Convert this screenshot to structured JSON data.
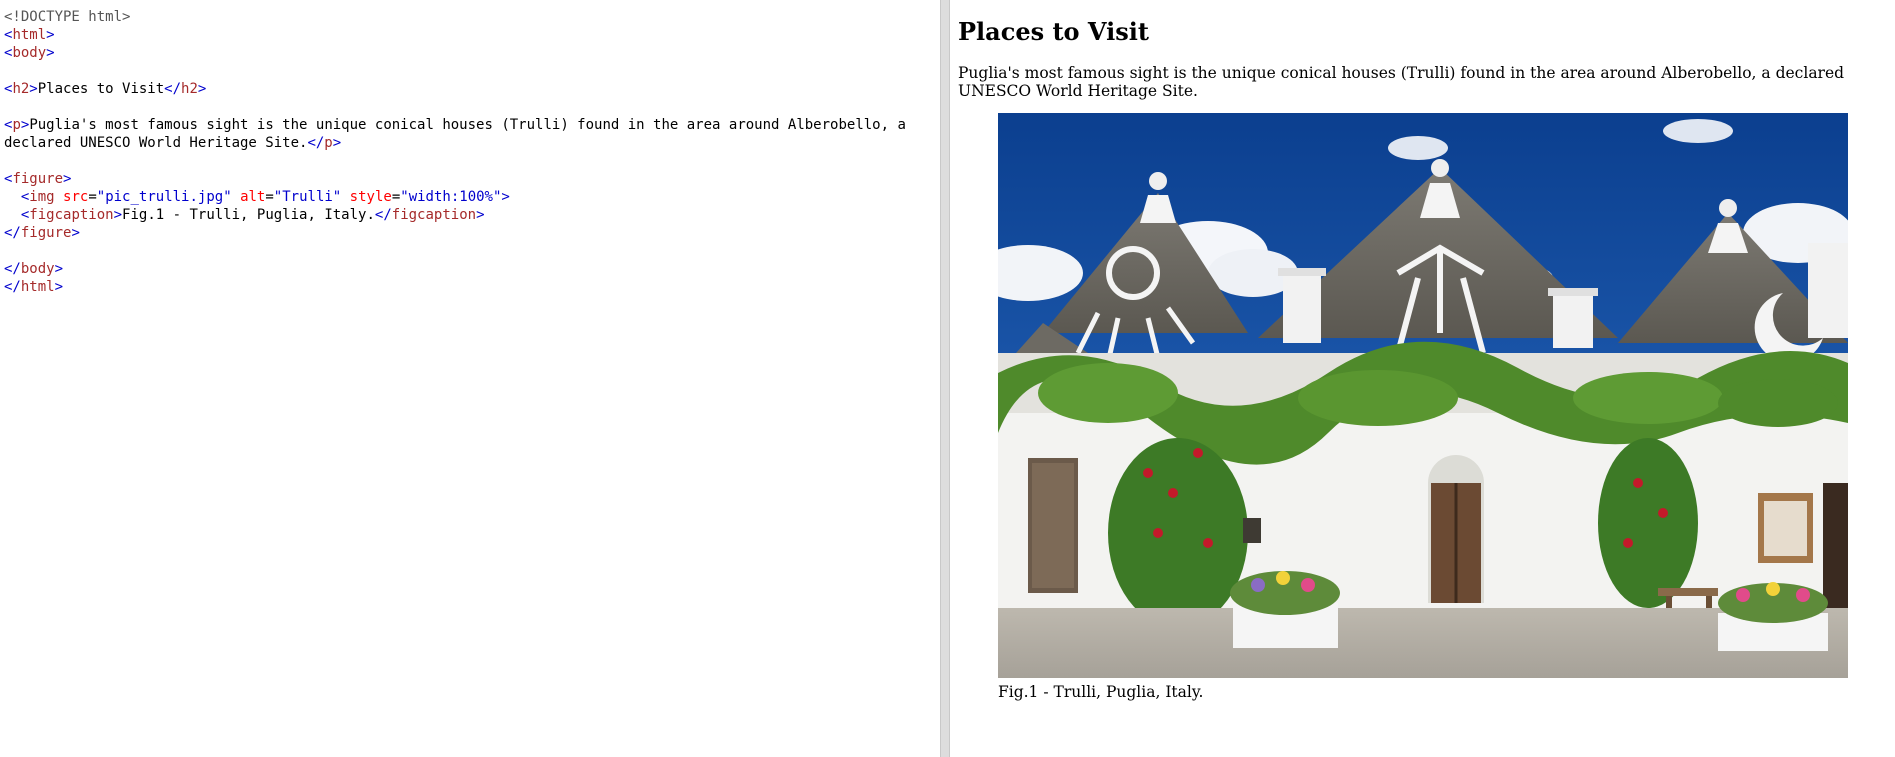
{
  "editor": {
    "lines": [
      [
        {
          "t": "doctype",
          "v": "<!DOCTYPE html>"
        }
      ],
      [
        {
          "t": "bracket",
          "v": "<"
        },
        {
          "t": "tag",
          "v": "html"
        },
        {
          "t": "bracket",
          "v": ">"
        }
      ],
      [
        {
          "t": "bracket",
          "v": "<"
        },
        {
          "t": "tag",
          "v": "body"
        },
        {
          "t": "bracket",
          "v": ">"
        }
      ],
      [],
      [
        {
          "t": "bracket",
          "v": "<"
        },
        {
          "t": "tag",
          "v": "h2"
        },
        {
          "t": "bracket",
          "v": ">"
        },
        {
          "t": "text",
          "v": "Places to Visit"
        },
        {
          "t": "bracket",
          "v": "</"
        },
        {
          "t": "tag",
          "v": "h2"
        },
        {
          "t": "bracket",
          "v": ">"
        }
      ],
      [],
      [
        {
          "t": "bracket",
          "v": "<"
        },
        {
          "t": "tag",
          "v": "p"
        },
        {
          "t": "bracket",
          "v": ">"
        },
        {
          "t": "text",
          "v": "Puglia's most famous sight is the unique conical houses (Trulli) found in the area around Alberobello, a declared UNESCO World Heritage Site."
        },
        {
          "t": "bracket",
          "v": "</"
        },
        {
          "t": "tag",
          "v": "p"
        },
        {
          "t": "bracket",
          "v": ">"
        }
      ],
      [],
      [
        {
          "t": "bracket",
          "v": "<"
        },
        {
          "t": "tag",
          "v": "figure"
        },
        {
          "t": "bracket",
          "v": ">"
        }
      ],
      [
        {
          "t": "text",
          "v": "  "
        },
        {
          "t": "bracket",
          "v": "<"
        },
        {
          "t": "tag",
          "v": "img"
        },
        {
          "t": "text",
          "v": " "
        },
        {
          "t": "attr",
          "v": "src"
        },
        {
          "t": "eq",
          "v": "="
        },
        {
          "t": "val",
          "v": "\"pic_trulli.jpg\""
        },
        {
          "t": "text",
          "v": " "
        },
        {
          "t": "attr",
          "v": "alt"
        },
        {
          "t": "eq",
          "v": "="
        },
        {
          "t": "val",
          "v": "\"Trulli\""
        },
        {
          "t": "text",
          "v": " "
        },
        {
          "t": "attr",
          "v": "style"
        },
        {
          "t": "eq",
          "v": "="
        },
        {
          "t": "val",
          "v": "\"width:100%\""
        },
        {
          "t": "bracket",
          "v": ">"
        }
      ],
      [
        {
          "t": "text",
          "v": "  "
        },
        {
          "t": "bracket",
          "v": "<"
        },
        {
          "t": "tag",
          "v": "figcaption"
        },
        {
          "t": "bracket",
          "v": ">"
        },
        {
          "t": "text",
          "v": "Fig.1 - Trulli, Puglia, Italy."
        },
        {
          "t": "bracket",
          "v": "</"
        },
        {
          "t": "tag",
          "v": "figcaption"
        },
        {
          "t": "bracket",
          "v": ">"
        }
      ],
      [
        {
          "t": "bracket",
          "v": "</"
        },
        {
          "t": "tag",
          "v": "figure"
        },
        {
          "t": "bracket",
          "v": ">"
        }
      ],
      [],
      [
        {
          "t": "bracket",
          "v": "</"
        },
        {
          "t": "tag",
          "v": "body"
        },
        {
          "t": "bracket",
          "v": ">"
        }
      ],
      [
        {
          "t": "bracket",
          "v": "</"
        },
        {
          "t": "tag",
          "v": "html"
        },
        {
          "t": "bracket",
          "v": ">"
        }
      ]
    ]
  },
  "preview": {
    "heading": "Places to Visit",
    "paragraph": "Puglia's most famous sight is the unique conical houses (Trulli) found in the area around Alberobello, a declared UNESCO World Heritage Site.",
    "image_alt": "Trulli",
    "caption": "Fig.1 - Trulli, Puglia, Italy."
  }
}
